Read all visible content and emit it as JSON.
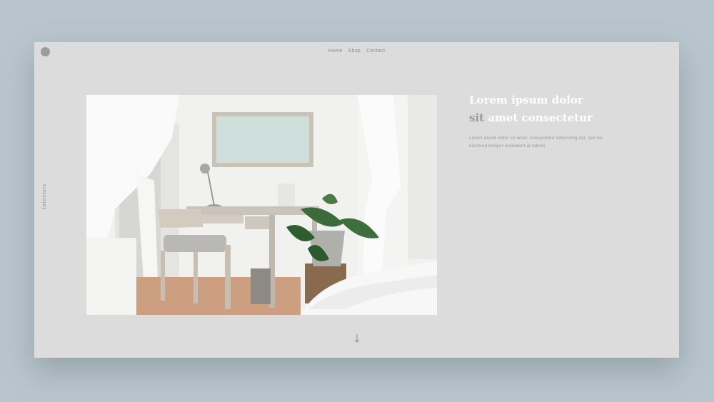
{
  "nav": {
    "items": [
      "Home",
      "Shop",
      "Contact"
    ]
  },
  "side_label": "Interiors",
  "hero": {
    "headline_line1": "Lorem ipsum dolor",
    "headline_word_muted": "sit",
    "headline_line2_rest": "amet consectetur",
    "body": "Lorem ipsum dolor sit amet, consectetur adipiscing elit, sed do eiusmod tempor incididunt ut labore."
  },
  "icons": {
    "logo": "logo-dot",
    "scroll": "arrow-down-icon"
  },
  "colors": {
    "background": "#b9c5cc",
    "card": "#dcdcdc",
    "headline": "#ffffff",
    "muted": "#9a9a9a"
  }
}
